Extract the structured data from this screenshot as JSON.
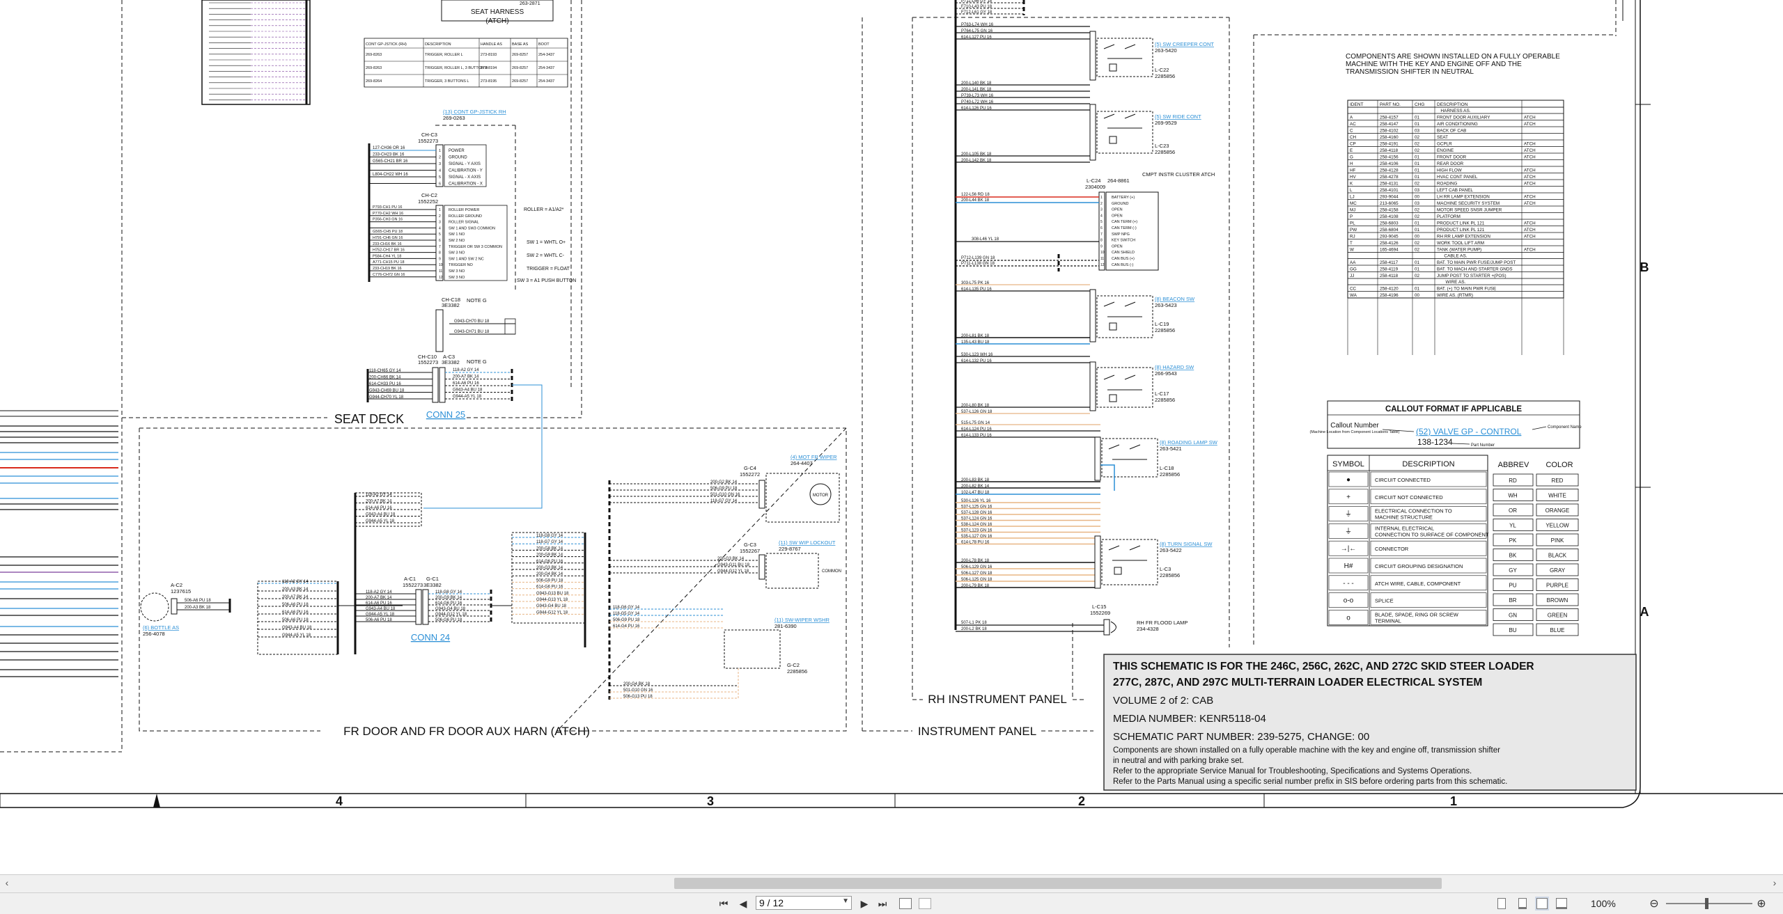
{
  "schematic": {
    "harness_notes": {
      "seat_harness_title": "SEAT HARNESS",
      "seat_harness_sub": "(ATCH)",
      "seat_harness_part": "263-2871",
      "cont_gp_table_headers": [
        "CONT GP-JSTICK (RH)",
        "DESCRIPTION",
        "HANDLE AS",
        "BASE AS",
        "BOOT"
      ],
      "cont_gp_table_rows": [
        [
          "269-8263",
          "TRIGGER, ROLLER L",
          "273-8193",
          "269-8257",
          "254-3437"
        ],
        [
          "269-8263",
          "TRIGGER, ROLLER L, 3 BUTTON R",
          "273-8194",
          "269-8257",
          "254-3437"
        ],
        [
          "269-8264",
          "TRIGGER, 3 BUTTONS L",
          "273-8195",
          "269-8257",
          "254-3437"
        ]
      ],
      "jstick_callout": "(13) CONT GP-JSTICK RH",
      "jstick_part": "269-0263",
      "ch_c3": "CH-C3",
      "ch_c3_part": "1552273",
      "ch_c3_pins": [
        "POWER",
        "GROUND",
        "SIGNAL - Y AXIS",
        "CALIBRATION - Y",
        "SIGNAL - X AXIS",
        "CALIBRATION - X"
      ],
      "ch_c2": "CH-C2",
      "ch_c2_part": "1552252",
      "ch_c2_pins": [
        "ROLLER POWER",
        "ROLLER GROUND",
        "ROLLER SIGNAL",
        "SW 1 AND SW3 COMMON",
        "SW 1 NO",
        "SW 2 NO",
        "TRIGGER OR SW 3 COMMON",
        "SW 3 NO",
        "SW 1 AND SW 2 NC",
        "TRIGGER NO",
        "SW 3 NO",
        "SW 3 NO"
      ],
      "roller_note": "ROLLER = A1/A2*",
      "sw1_note": "SW 1 = WHTL O+",
      "sw2_note": "SW 2 = WHTL C-",
      "trigger_note": "TRIGGER = FLOAT",
      "sw3_note": "SW 3 = A1 PUSH BUTTON",
      "ch_c18": "CH-C18",
      "ch_c18_part": "3E3382",
      "note_g": "NOTE G",
      "ch_c10": "CH-C10",
      "ch_c10_part": "1552273",
      "a_c3": "A-C3",
      "a_c3_part": "3E3382",
      "conn25": "CONN 25",
      "seat_deck": "SEAT DECK",
      "conn24": "CONN 24",
      "fr_door_label": "FR DOOR AND FR DOOR AUX HARN (ATCH)",
      "a_c2": "A-C2",
      "a_c2_part": "1237615",
      "bottle_callout": "(6) BOTTLE AS",
      "bottle_part": "256-4078",
      "a_c1": "A-C1",
      "a_c1_part": "1552273",
      "g_c1": "G-C1",
      "g_c1_part": "3E3382",
      "g_c4": "G-C4",
      "g_c4_part": "1552272",
      "wiper_motor_callout": "(4) MOT FR WIPER",
      "wiper_motor_part": "264-4407",
      "motor_label": "MOTOR",
      "g_c3": "G-C3",
      "g_c3_part": "1552267",
      "lockout_callout": "(11) SW WIP LOCKOUT",
      "lockout_part": "229-8767",
      "common_label": "COMMON",
      "wiper_wshr_callout": "(11) SW-WIPER WSHR",
      "wiper_wshr_part": "281-6390",
      "g_c2": "G-C2",
      "g_c2_part": "2285856"
    },
    "rh_panel": {
      "creeper_callout": "(5) SW CREEPER CONT",
      "creeper_part": "263-5420",
      "creeper_conn": "L-C22",
      "creeper_conn_part": "2285856",
      "ride_callout": "(5) SW RIDE CONT",
      "ride_part": "269-9529",
      "ride_conn": "L-C23",
      "ride_conn_part": "2285856",
      "cluster_title": "CMPT INSTR CLUSTER ATCH",
      "cluster_conn": "L-C24",
      "cluster_part": "264-8861",
      "cluster_conn_part": "2304009",
      "cluster_pins": [
        "BATTERY (+)",
        "GROUND",
        "OPEN",
        "OPEN",
        "CAN TERM (+)",
        "CAN TERM (-)",
        "SWP NPG",
        "KEY SWITCH",
        "OPEN",
        "CAN SHIELD",
        "CAN BUS (+)",
        "CAN BUS (-)"
      ],
      "beacon_callout": "(8) BEACON SW",
      "beacon_part": "263-5423",
      "beacon_conn": "L-C19",
      "beacon_conn_part": "2285856",
      "hazard_callout": "(8) HAZARD SW",
      "hazard_part": "266-9543",
      "hazard_conn": "L-C17",
      "hazard_conn_part": "2285856",
      "roading_callout": "(8) ROADING LAMP SW",
      "roading_part": "263-5421",
      "roading_conn": "L-C18",
      "roading_conn_part": "2285856",
      "turn_callout": "(8) TURN SIGNAL SW",
      "turn_part": "263-5422",
      "turn_conn": "L-C3",
      "turn_conn_part": "2285856",
      "flood_conn": "L-C15",
      "flood_conn_part": "1552269",
      "flood_label": "RH FR FLOOD LAMP",
      "flood_part": "234-4328",
      "rh_panel_label": "RH INSTRUMENT PANEL",
      "instrument_panel_label": "INSTRUMENT PANEL"
    },
    "components": {
      "note": [
        "COMPONENTS ARE SHOWN INSTALLED ON A FULLY OPERABLE",
        "MACHINE WITH THE KEY AND ENGINE OFF AND THE",
        "TRANSMISSION SHIFTER IN NEUTRAL"
      ],
      "headers": [
        "IDENT",
        "PART NO.",
        "CHG",
        "DESCRIPTION",
        ""
      ],
      "harness_caption": "HARNESS AS.",
      "harness_rows": [
        [
          "A",
          "258-4157",
          "01",
          "FRONT DOOR AUXILIARY",
          "ATCH"
        ],
        [
          "AC",
          "258-4147",
          "01",
          "AIR CONDITIONING",
          "ATCH"
        ],
        [
          "C",
          "258-4102",
          "03",
          "BACK OF CAB",
          ""
        ],
        [
          "CH",
          "258-4160",
          "02",
          "SEAT",
          ""
        ],
        [
          "CP",
          "258-4191",
          "02",
          "GCPLR",
          "ATCH"
        ],
        [
          "E",
          "258-4118",
          "02",
          "ENGINE",
          "ATCH"
        ],
        [
          "G",
          "258-4156",
          "01",
          "FRONT DOOR",
          "ATCH"
        ],
        [
          "H",
          "258-4106",
          "01",
          "REAR DOOR",
          ""
        ],
        [
          "HF",
          "258-4128",
          "01",
          "HIGH FLOW",
          "ATCH"
        ],
        [
          "HV",
          "258-4278",
          "01",
          "HVAC CONT PANEL",
          "ATCH"
        ],
        [
          "K",
          "258-4131",
          "02",
          "ROADING",
          "ATCH"
        ],
        [
          "L",
          "258-4101",
          "03",
          "LEFT CAB PANEL",
          ""
        ],
        [
          "LJ",
          "293-9044",
          "00",
          "LH RR LAMP EXTENSION",
          "ATCH"
        ],
        [
          "MC",
          "213-6065",
          "03",
          "MACHINE SECURITY SYSTEM",
          "ATCH"
        ],
        [
          "MJ",
          "258-4158",
          "02",
          "MOTOR SPEED SNSR JUMPER",
          ""
        ],
        [
          "P",
          "258-4108",
          "02",
          "PLATFORM",
          ""
        ],
        [
          "PL",
          "258-6803",
          "01",
          "PRODUCT LINK PL 121",
          "ATCH"
        ],
        [
          "PW",
          "258-6804",
          "01",
          "PRODUCT LINK PL 121",
          "ATCH"
        ],
        [
          "RJ",
          "293-9045",
          "00",
          "RH RR LAMP EXTENSION",
          "ATCH"
        ],
        [
          "T",
          "258-4126",
          "02",
          "WORK TOOL LIFT ARM",
          ""
        ],
        [
          "W",
          "165-4694",
          "02",
          "TANK (WATER PUMP)",
          "ATCH"
        ]
      ],
      "cable_caption": "CABLE AS.",
      "cable_rows": [
        [
          "AA",
          "258-4117",
          "01",
          "BAT. TO MAIN PWR FUSE/JUMP POST",
          ""
        ],
        [
          "GG",
          "258-4119",
          "01",
          "BAT. TO MACH AND STARTER GNDS",
          ""
        ],
        [
          "JJ",
          "258-4118",
          "02",
          "JUMP POST TO STARTER +(POS)",
          ""
        ]
      ],
      "wire_caption": "WIRE AS.",
      "wire_rows": [
        [
          "CC",
          "258-4120",
          "01",
          "BAT. (+) TO MAIN PWR FUSE",
          ""
        ],
        [
          "WA",
          "258-4196",
          "00",
          "WIRE AS. (RTMR)",
          ""
        ]
      ]
    },
    "callout_format": {
      "title": "CALLOUT FORMAT IF APPLICABLE",
      "callout_number": "Callout Number",
      "callout_desc": "(Machine Location from Component Locations Table)",
      "example": "(52) VALVE GP - CONTROL",
      "part_example": "138-1234",
      "component_name": "Component Name",
      "part_number": "Part Number"
    },
    "symbols": {
      "header_symbol": "SYMBOL",
      "header_desc": "DESCRIPTION",
      "rows": [
        {
          "sym": "●",
          "desc": "CIRCUIT CONNECTED"
        },
        {
          "sym": "+",
          "desc": "CIRCUIT NOT CONNECTED"
        },
        {
          "sym": "⏚",
          "desc": "ELECTRICAL CONNECTION TO MACHINE STRUCTURE"
        },
        {
          "sym": "⏚",
          "desc": "INTERNAL ELECTRICAL CONNECTION TO SURFACE OF COMPONENT"
        },
        {
          "sym": "→|←",
          "desc": "CONNECTOR"
        },
        {
          "sym": "H#",
          "desc": "CIRCUIT GROUPING DESIGNATION"
        },
        {
          "sym": "- - -",
          "desc": "ATCH WIRE, CABLE, COMPONENT"
        },
        {
          "sym": "o-o",
          "desc": "SPLICE"
        },
        {
          "sym": "o",
          "desc": "BLADE, SPADE, RING OR SCREW TERMINAL"
        }
      ]
    },
    "colors": {
      "header_abbrev": "ABBREV",
      "header_color": "COLOR",
      "rows": [
        [
          "RD",
          "RED"
        ],
        [
          "WH",
          "WHITE"
        ],
        [
          "OR",
          "ORANGE"
        ],
        [
          "YL",
          "YELLOW"
        ],
        [
          "PK",
          "PINK"
        ],
        [
          "BK",
          "BLACK"
        ],
        [
          "GY",
          "GRAY"
        ],
        [
          "PU",
          "PURPLE"
        ],
        [
          "BR",
          "BROWN"
        ],
        [
          "GN",
          "GREEN"
        ],
        [
          "BU",
          "BLUE"
        ]
      ]
    },
    "title_block": {
      "line1": "THIS SCHEMATIC IS FOR THE 246C, 256C, 262C, AND 272C SKID STEER LOADER",
      "line2": "277C, 287C, AND 297C MULTI-TERRAIN LOADER ELECTRICAL SYSTEM",
      "volume": "VOLUME 2 of 2: CAB",
      "media": "MEDIA NUMBER: KENR5118-04",
      "part": "SCHEMATIC PART NUMBER: 239-5275, CHANGE: 00",
      "note1": "Components are shown installed on a fully operable machine with the key and engine off, transmission shifter",
      "note2": "in neutral and with parking brake set.",
      "note3": "Refer to the appropriate Service Manual for Troubleshooting, Specifications and Systems Operations.",
      "note4": "Refer to the Parts Manual using a specific serial number prefix in SIS before ordering parts from this schematic."
    },
    "grid": {
      "columns": [
        "4",
        "3",
        "2",
        "1"
      ],
      "rows": [
        "B",
        "A"
      ]
    },
    "wire_colors": {
      "blue": "#2b8fd6",
      "red": "#d9291c",
      "orange": "#e8b584",
      "black": "#111111",
      "green": "#1a9c6a",
      "purple": "#7a3d9a"
    }
  },
  "viewer": {
    "page_value": "9 / 12",
    "zoom": "100%"
  }
}
